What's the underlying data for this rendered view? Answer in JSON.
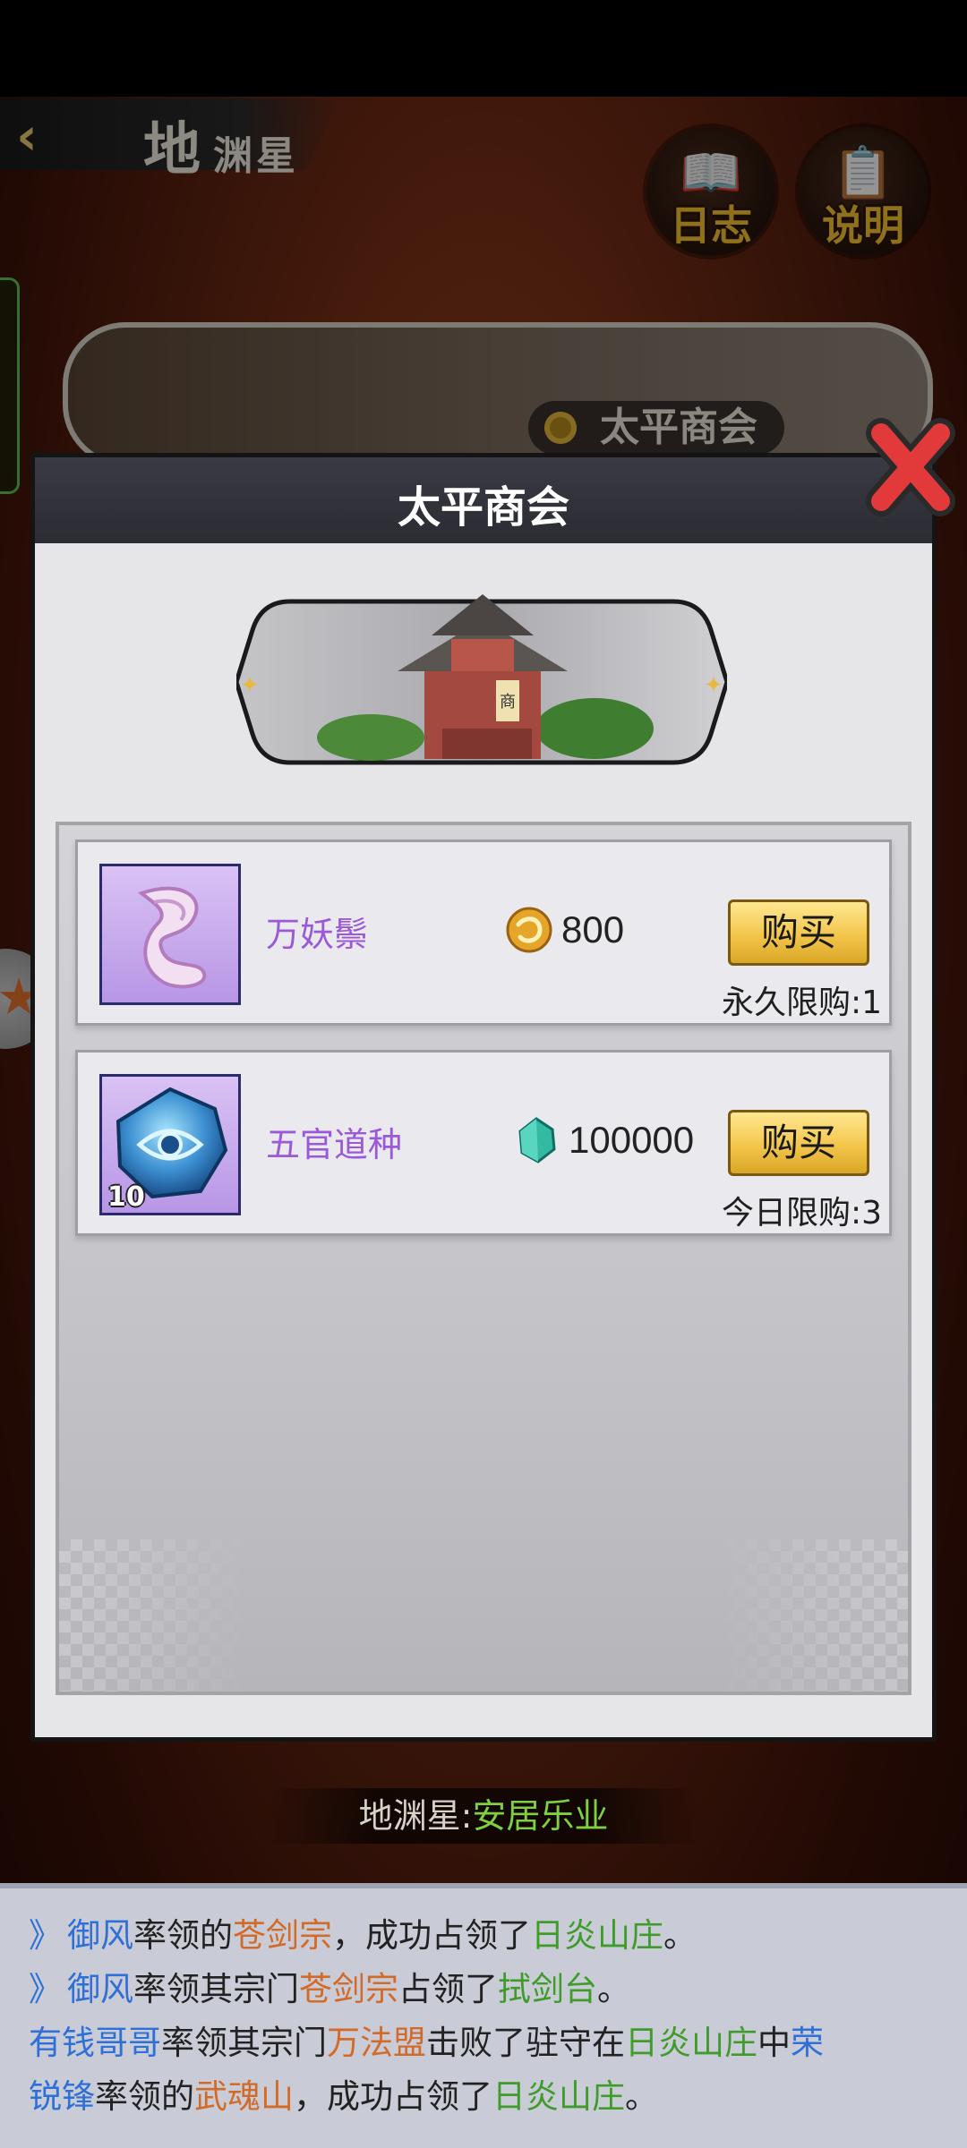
{
  "header": {
    "title_big": "地",
    "title_rest": "渊星"
  },
  "corner_buttons": [
    {
      "label": "日志"
    },
    {
      "label": "说明"
    }
  ],
  "background_banner": {
    "label": "太平商会"
  },
  "dialog": {
    "title": "太平商会",
    "items": [
      {
        "name": "万妖鬃",
        "price": "800",
        "currency_icon": "gold-coin-icon",
        "buy_label": "购买",
        "limit": "永久限购:1",
        "count": ""
      },
      {
        "name": "五官道种",
        "price": "100000",
        "currency_icon": "jade-crystal-icon",
        "buy_label": "购买",
        "limit": "今日限购:3",
        "count": "10"
      }
    ]
  },
  "status": {
    "prefix": "地渊星:",
    "value": "安居乐业"
  },
  "log": [
    {
      "parts": [
        "御风",
        "率领的",
        "苍剑宗",
        "，成功占领了",
        "日炎山庄",
        "。"
      ]
    },
    {
      "parts": [
        "御风",
        "率领其宗门",
        "苍剑宗",
        "占领了",
        "拭剑台",
        "。"
      ]
    },
    {
      "parts": [
        "有钱哥哥",
        "率领其宗门",
        "万法盟",
        "击败了驻守在",
        "日炎山庄",
        "中",
        "荣"
      ]
    },
    {
      "parts": [
        "锐锋",
        "率领的",
        "武魂山",
        "，成功占领了",
        "日炎山庄",
        "。"
      ]
    }
  ],
  "colors": {
    "accent_purple": "#9a59d8",
    "buy_gold": "#f3c64b",
    "log_blue": "#2f6fd8",
    "log_orange": "#d26a2a",
    "log_green": "#3f9c2a"
  }
}
